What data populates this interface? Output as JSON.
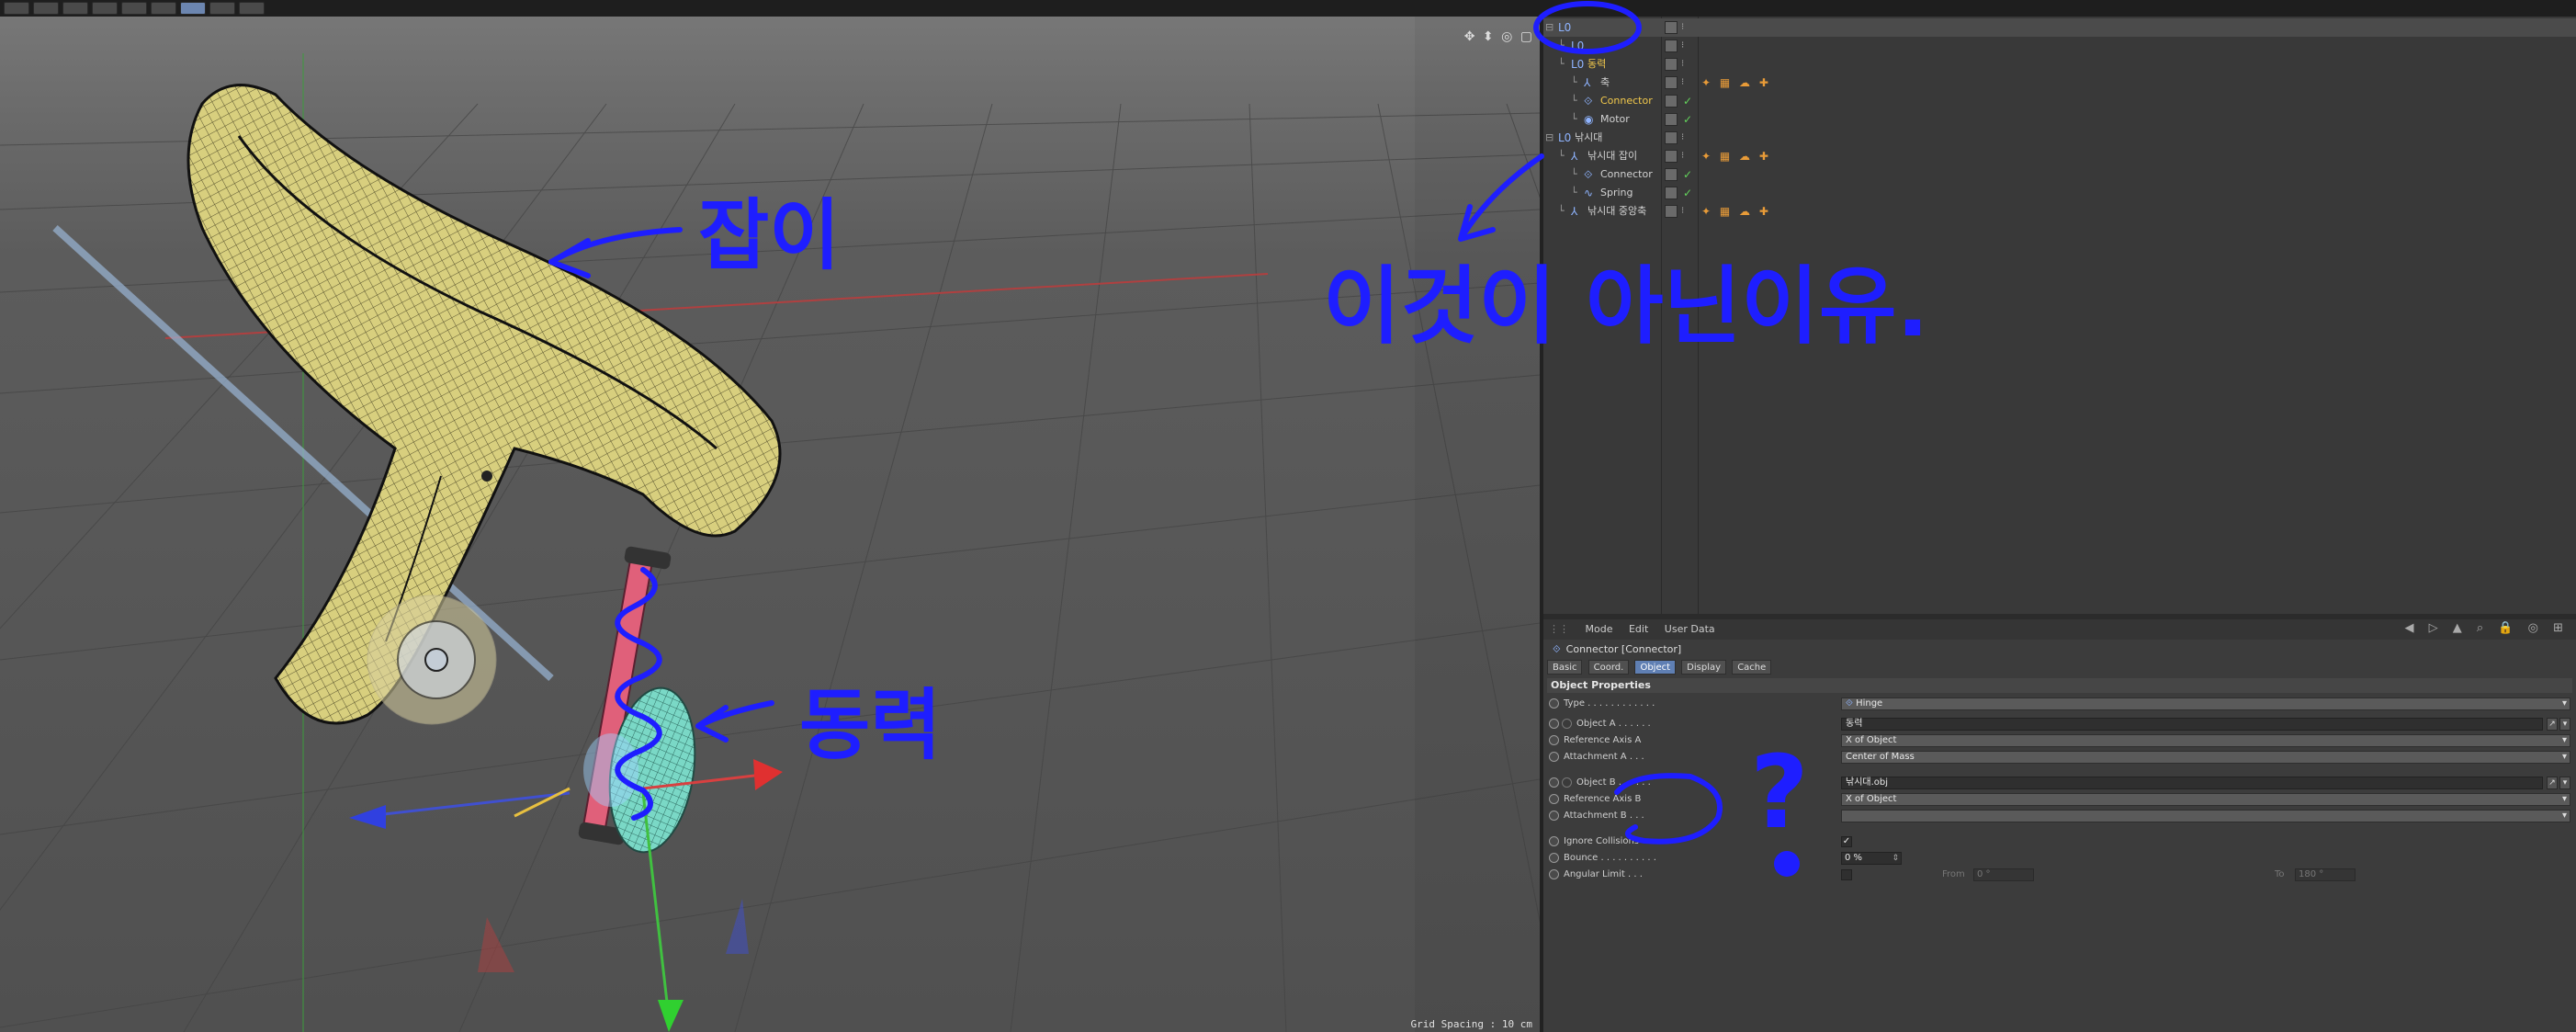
{
  "viewport": {
    "grid_spacing": "Grid Spacing : 10 cm",
    "nav_icons": "✥ ⬍ ◎ ▢"
  },
  "object_manager": {
    "rows": [
      {
        "name": "",
        "indent": 0,
        "icon": "null-icon"
      },
      {
        "name": "",
        "indent": 1,
        "icon": "null-icon"
      },
      {
        "name": "동력",
        "indent": 1,
        "icon": "null-icon",
        "highlight": true
      },
      {
        "name": "축",
        "indent": 2,
        "icon": "joint-icon"
      },
      {
        "name": "Connector",
        "indent": 2,
        "icon": "connector-icon",
        "highlight": true
      },
      {
        "name": "Motor",
        "indent": 2,
        "icon": "motor-icon"
      },
      {
        "name": "낚시대",
        "indent": 0,
        "icon": "null-icon"
      },
      {
        "name": "낚시대 잡이",
        "indent": 1,
        "icon": "joint-icon"
      },
      {
        "name": "Connector",
        "indent": 2,
        "icon": "connector-icon"
      },
      {
        "name": "Spring",
        "indent": 2,
        "icon": "spring-icon"
      },
      {
        "name": "낚시대 중앙축",
        "indent": 1,
        "icon": "joint-icon"
      }
    ],
    "tag_glyphs": "✦ ▦ ☁ ✚"
  },
  "attributes": {
    "menu": [
      "Mode",
      "Edit",
      "User Data"
    ],
    "tool_icons": "◀ ▷ ▲ ⌕ 🔒 ◎ ⊞",
    "title": "Connector [Connector]",
    "tabs": [
      "Basic",
      "Coord.",
      "Object",
      "Display",
      "Cache"
    ],
    "active_tab": "Object",
    "section": "Object Properties",
    "type_label": "Type . . . . . . . . . . . .",
    "type_value": "Hinge",
    "object_a_label": "Object A . . . . . .",
    "object_a_value": "동력",
    "ref_axis_a_label": "Reference Axis A",
    "ref_axis_a_value": "X of Object",
    "attach_a_label": "Attachment A . . .",
    "attach_a_value": "Center of Mass",
    "object_b_label": "Object B . . . . . .",
    "object_b_value": "낚시대.obj",
    "ref_axis_b_label": "Reference Axis B",
    "ref_axis_b_value": "X of Object",
    "attach_b_label": "Attachment B . . .",
    "attach_b_value": "",
    "ignore_collisions_label": "Ignore Collisions",
    "ignore_collisions_value": "✓",
    "bounce_label": "Bounce . . . . . . . . . .",
    "bounce_value": "0 %",
    "angular_limit_label": "Angular Limit . . .",
    "from_label": "From",
    "from_value": "0 °",
    "to_label": "To",
    "to_value": "180 °"
  },
  "annotations": {
    "handle_label": "잡이",
    "power_label": "동력",
    "reason_label": "이것이 아닌이유.",
    "question_mark": "?",
    "ink_color": "#1e1eff"
  },
  "colors": {
    "handle_fill": "#d8cf7e",
    "spring_fill": "#e0607a",
    "wheel_fill": "#7ad8c6"
  }
}
